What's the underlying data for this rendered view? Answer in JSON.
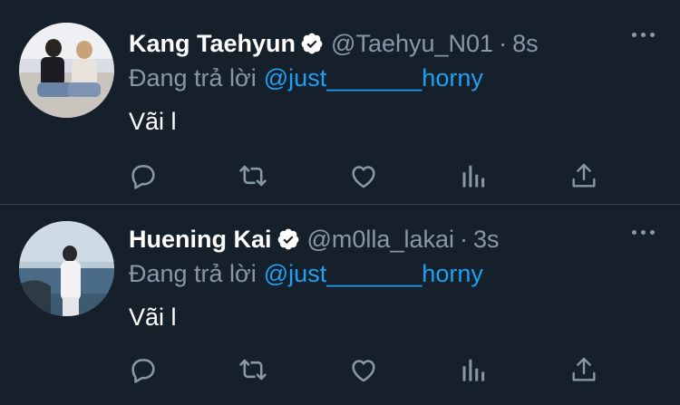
{
  "tweets": [
    {
      "name": "Kang Taehyun",
      "handle": "@Taehyu_N01",
      "separator": "·",
      "time": "8s",
      "reply_label": "Đang trả lời",
      "reply_to": "@just_______horny",
      "text": "Vãi l",
      "verified": true
    },
    {
      "name": "Huening Kai",
      "handle": "@m0lla_lakai",
      "separator": "·",
      "time": "3s",
      "reply_label": "Đang trả lời",
      "reply_to": "@just_______horny",
      "text": "Vãi l",
      "verified": true
    }
  ],
  "icons": [
    "verified-badge-icon",
    "more-icon",
    "reply-icon",
    "retweet-icon",
    "like-icon",
    "stats-icon",
    "share-icon"
  ],
  "colors": {
    "background": "#15202b",
    "divider": "#38444d",
    "text": "#ffffff",
    "secondary": "#8899a6",
    "accent": "#1da1f2"
  }
}
